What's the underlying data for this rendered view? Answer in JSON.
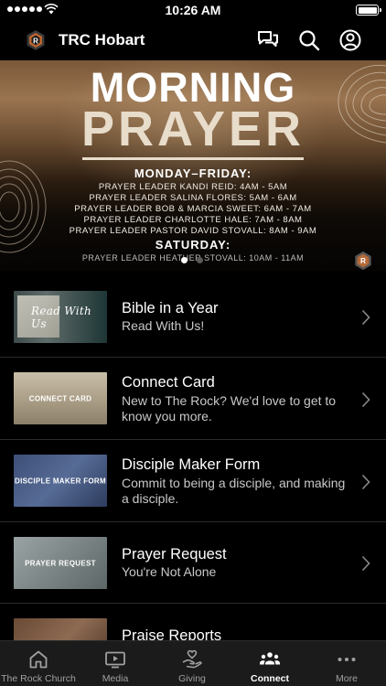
{
  "status_bar": {
    "time": "10:26 AM"
  },
  "header": {
    "title": "TRC Hobart"
  },
  "banner": {
    "title_line_1": "MORNING",
    "title_line_2": "PRAYER",
    "weekday_heading": "MONDAY–FRIDAY:",
    "weekday_lines": [
      "PRAYER LEADER KANDI REID: 4AM - 5AM",
      "PRAYER LEADER SALINA FLORES: 5AM - 6AM",
      "PRAYER LEADER BOB & MARCIA SWEET: 6AM - 7AM",
      "PRAYER LEADER CHARLOTTE HALE: 7AM - 8AM",
      "PRAYER LEADER PASTOR DAVID STOVALL: 8AM - 9AM"
    ],
    "saturday_heading": "SATURDAY:",
    "saturday_line": "PRAYER LEADER HEATHER STOVALL: 10AM - 11AM",
    "page_count": 2,
    "active_page": 1
  },
  "list": {
    "items": [
      {
        "thumb_label": "Read With Us",
        "title": "Bible in a Year",
        "subtitle": "Read With Us!"
      },
      {
        "thumb_label": "CONNECT CARD",
        "title": "Connect Card",
        "subtitle": "New to The Rock? We'd love to get to know you more."
      },
      {
        "thumb_label": "DISCIPLE MAKER FORM",
        "title": "Disciple Maker Form",
        "subtitle": "Commit to being a disciple, and making a disciple."
      },
      {
        "thumb_label": "PRAYER REQUEST",
        "title": "Prayer Request",
        "subtitle": "You're Not Alone"
      },
      {
        "thumb_label": "",
        "title": "Praise Reports",
        "subtitle": ""
      }
    ]
  },
  "tabbar": {
    "tabs": [
      {
        "label": "The Rock Church",
        "icon": "home-icon"
      },
      {
        "label": "Media",
        "icon": "media-icon"
      },
      {
        "label": "Giving",
        "icon": "giving-icon"
      },
      {
        "label": "Connect",
        "icon": "connect-icon",
        "active": true
      },
      {
        "label": "More",
        "icon": "more-icon"
      }
    ]
  },
  "colors": {
    "background": "#000000",
    "tabbar_bg": "#1b1b1b",
    "banner_cream": "#e8dccb",
    "subtitle": "#c8c8c8",
    "inactive_tab": "#a0a0a0"
  }
}
